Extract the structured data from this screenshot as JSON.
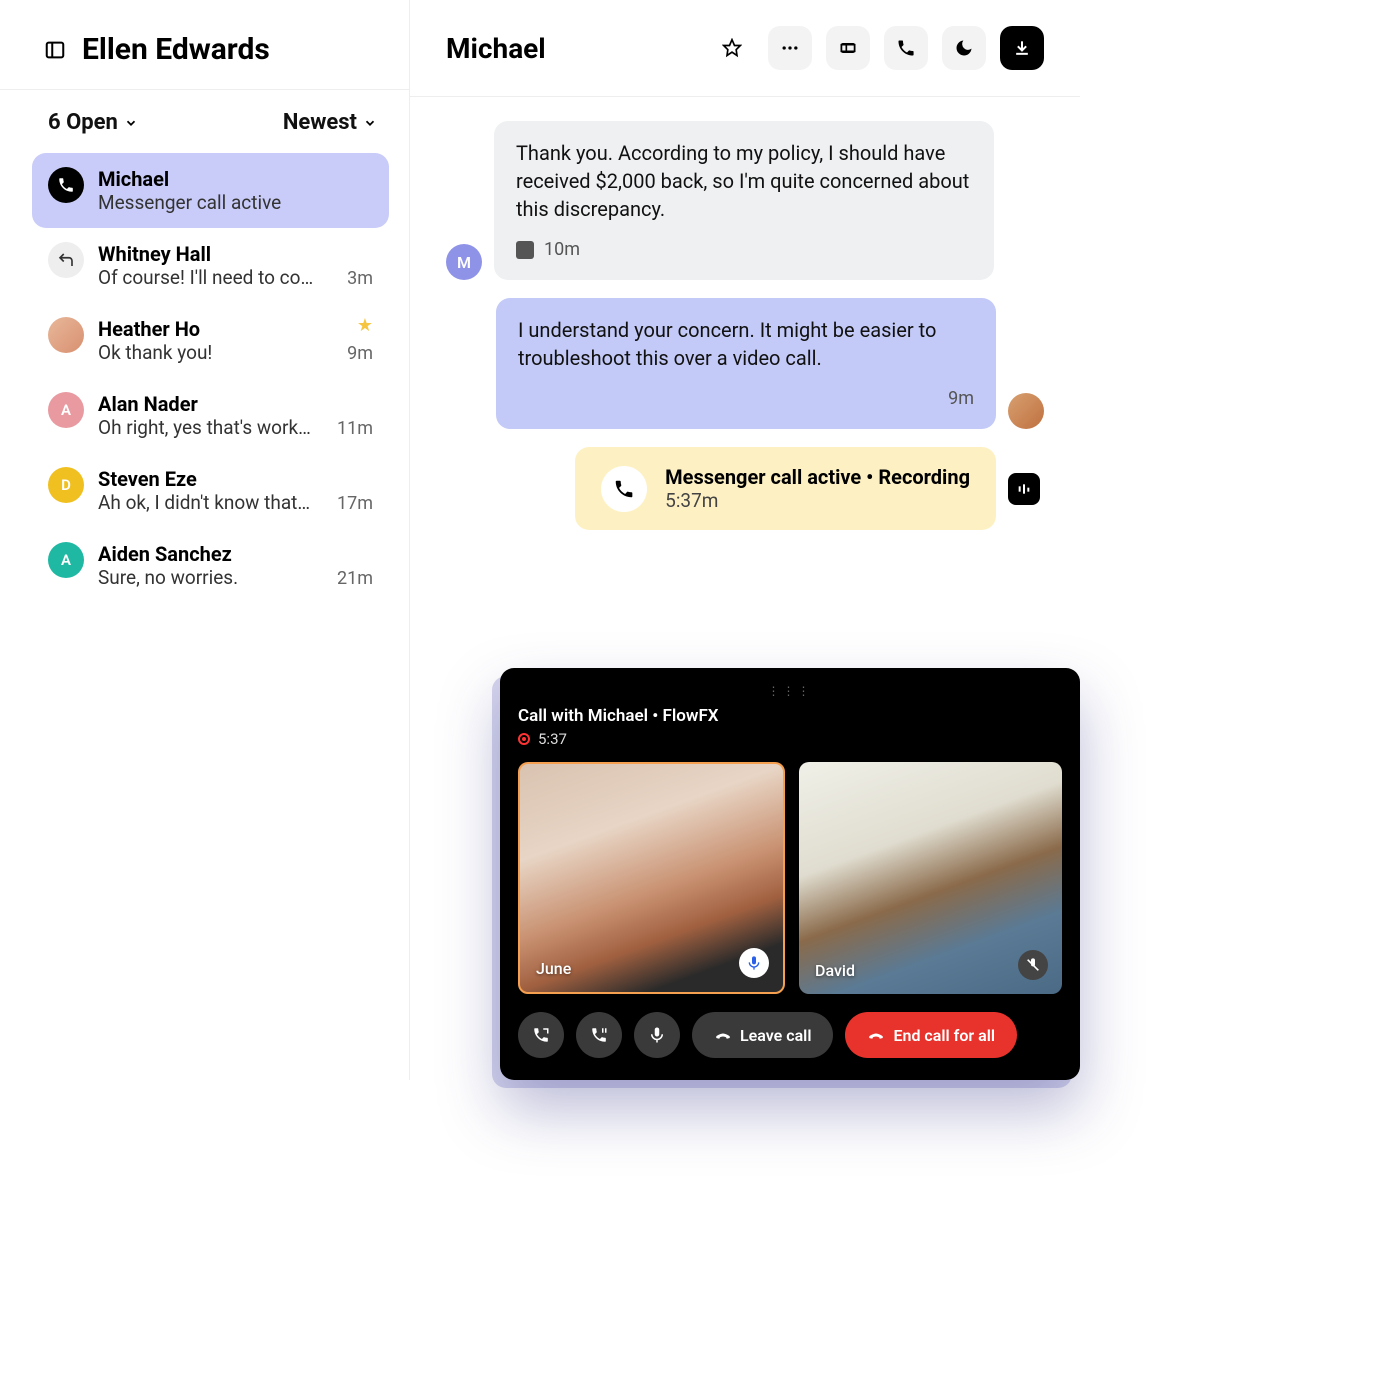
{
  "sidebar": {
    "owner": "Ellen Edwards",
    "filter_open": "6 Open",
    "filter_sort": "Newest",
    "conversations": [
      {
        "name": "Michael",
        "preview": "Messenger call active",
        "time": "",
        "icon_letter": "",
        "starred": false
      },
      {
        "name": "Whitney Hall",
        "preview": "Of course! I'll need to co…",
        "time": "3m",
        "icon_letter": "",
        "starred": false
      },
      {
        "name": "Heather Ho",
        "preview": "Ok thank you!",
        "time": "9m",
        "icon_letter": "",
        "starred": true
      },
      {
        "name": "Alan Nader",
        "preview": "Oh right, yes that's work…",
        "time": "11m",
        "icon_letter": "A",
        "starred": false
      },
      {
        "name": "Steven Eze",
        "preview": "Ah ok, I didn't know that…",
        "time": "17m",
        "icon_letter": "D",
        "starred": false
      },
      {
        "name": "Aiden Sanchez",
        "preview": "Sure, no worries.",
        "time": "21m",
        "icon_letter": "A",
        "starred": false
      }
    ]
  },
  "conversation": {
    "title": "Michael",
    "messages": {
      "in1_text": "Thank you. According to my policy, I should have received $2,000 back, so I'm quite concerned about this discrepancy.",
      "in1_time": "10m",
      "in1_avatar_letter": "M",
      "out1_text": "I understand your concern. It might be easier to troubleshoot this over a video call.",
      "out1_time": "9m"
    },
    "call_status": {
      "title": "Messenger call active • Recording",
      "time": "5:37m"
    }
  },
  "call_window": {
    "title": "Call with Michael • FlowFX",
    "duration": "5:37",
    "participants": [
      {
        "name": "June",
        "muted": false
      },
      {
        "name": "David",
        "muted": true
      }
    ],
    "leave_label": "Leave call",
    "end_label": "End call for all"
  }
}
